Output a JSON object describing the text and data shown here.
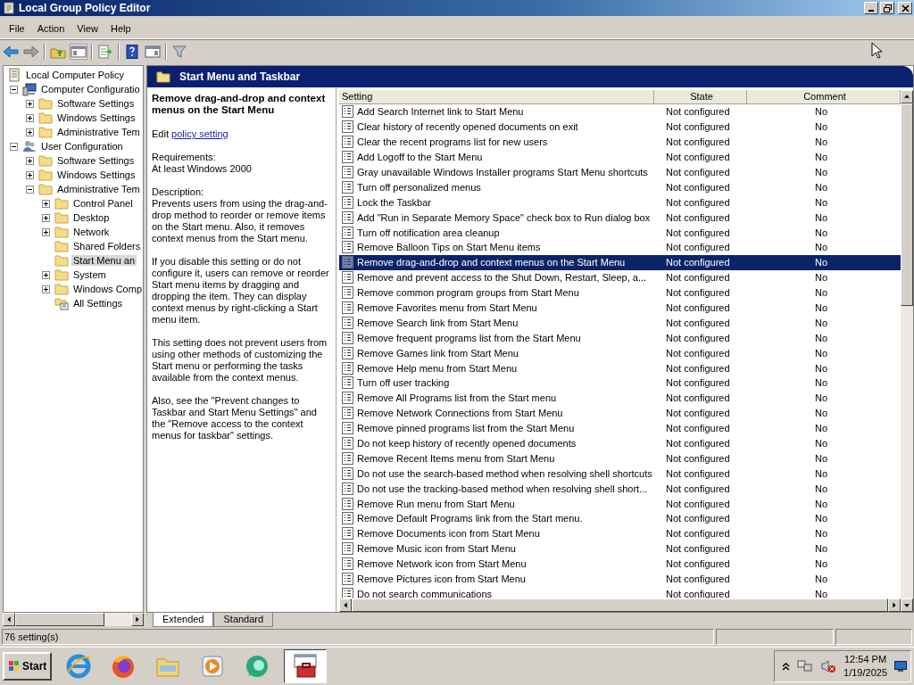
{
  "window": {
    "title": "Local Group Policy Editor"
  },
  "menu": [
    "File",
    "Action",
    "View",
    "Help"
  ],
  "toolbar": [
    {
      "kind": "back"
    },
    {
      "kind": "forward"
    },
    {
      "kind": "sep"
    },
    {
      "kind": "folder-up"
    },
    {
      "kind": "tree-toggle"
    },
    {
      "kind": "sep"
    },
    {
      "kind": "export"
    },
    {
      "kind": "sep"
    },
    {
      "kind": "help"
    },
    {
      "kind": "pane"
    },
    {
      "kind": "sep"
    },
    {
      "kind": "filter"
    }
  ],
  "tree": [
    {
      "label": "Local Computer Policy",
      "kind": "policy",
      "selected": false,
      "children": [
        {
          "label": "Computer Configuratio",
          "kind": "computer",
          "expanded": true,
          "selected": false,
          "children": [
            {
              "label": "Software Settings",
              "kind": "folder",
              "expanded": false,
              "selected": false
            },
            {
              "label": "Windows Settings",
              "kind": "folder",
              "expanded": false,
              "selected": false
            },
            {
              "label": "Administrative Tem",
              "kind": "folder",
              "expanded": false,
              "selected": false
            }
          ]
        },
        {
          "label": "User Configuration",
          "kind": "user",
          "expanded": true,
          "selected": false,
          "children": [
            {
              "label": "Software Settings",
              "kind": "folder",
              "expanded": false,
              "selected": false
            },
            {
              "label": "Windows Settings",
              "kind": "folder",
              "expanded": false,
              "selected": false
            },
            {
              "label": "Administrative Tem",
              "kind": "folder",
              "expanded": true,
              "selected": false,
              "children": [
                {
                  "label": "Control Panel",
                  "kind": "folder",
                  "expanded": false,
                  "selected": false
                },
                {
                  "label": "Desktop",
                  "kind": "folder",
                  "expanded": false,
                  "selected": false
                },
                {
                  "label": "Network",
                  "kind": "folder",
                  "expanded": false,
                  "selected": false
                },
                {
                  "label": "Shared Folders",
                  "kind": "folder",
                  "selected": false
                },
                {
                  "label": "Start Menu an",
                  "kind": "folder",
                  "selected": true
                },
                {
                  "label": "System",
                  "kind": "folder",
                  "expanded": false,
                  "selected": false
                },
                {
                  "label": "Windows Comp",
                  "kind": "folder",
                  "expanded": false,
                  "selected": false
                },
                {
                  "label": "All Settings",
                  "kind": "settings",
                  "selected": false
                }
              ]
            }
          ]
        }
      ]
    }
  ],
  "pane_title": "Start Menu and Taskbar",
  "description": {
    "title": "Remove drag-and-drop and context menus on the Start Menu",
    "edit_prefix": "Edit",
    "edit_link": "policy setting",
    "requirements_label": "Requirements:",
    "requirements": "At least Windows 2000",
    "description_label": "Description:",
    "paragraphs": [
      "Prevents users from using the drag-and-drop method to reorder or remove items on the Start menu. Also, it removes context menus from the Start menu.",
      "If you disable this setting or do not configure it, users can remove or reorder Start menu items by dragging and dropping the item. They can display context menus by right-clicking a Start menu item.",
      "This setting does not prevent users from using other methods of customizing the Start menu or performing the tasks available from the context menus.",
      "Also, see the \"Prevent changes to Taskbar and Start Menu Settings\" and the \"Remove access to the context menus for taskbar\" settings."
    ]
  },
  "table": {
    "columns": [
      "Setting",
      "State",
      "Comment"
    ],
    "rows": [
      {
        "setting": "Add Search Internet link to Start Menu",
        "state": "Not configured",
        "comment": "No",
        "selected": false
      },
      {
        "setting": "Clear history of recently opened documents on exit",
        "state": "Not configured",
        "comment": "No",
        "selected": false
      },
      {
        "setting": "Clear the recent programs list for new users",
        "state": "Not configured",
        "comment": "No",
        "selected": false
      },
      {
        "setting": "Add Logoff to the Start Menu",
        "state": "Not configured",
        "comment": "No",
        "selected": false
      },
      {
        "setting": "Gray unavailable Windows Installer programs Start Menu shortcuts",
        "state": "Not configured",
        "comment": "No",
        "selected": false
      },
      {
        "setting": "Turn off personalized menus",
        "state": "Not configured",
        "comment": "No",
        "selected": false
      },
      {
        "setting": "Lock the Taskbar",
        "state": "Not configured",
        "comment": "No",
        "selected": false
      },
      {
        "setting": "Add \"Run in Separate Memory Space\" check box to Run dialog box",
        "state": "Not configured",
        "comment": "No",
        "selected": false
      },
      {
        "setting": "Turn off notification area cleanup",
        "state": "Not configured",
        "comment": "No",
        "selected": false
      },
      {
        "setting": "Remove Balloon Tips on Start Menu items",
        "state": "Not configured",
        "comment": "No",
        "selected": false
      },
      {
        "setting": "Remove drag-and-drop and context menus on the Start Menu",
        "state": "Not configured",
        "comment": "No",
        "selected": true
      },
      {
        "setting": "Remove and prevent access to the Shut Down, Restart, Sleep, a...",
        "state": "Not configured",
        "comment": "No",
        "selected": false
      },
      {
        "setting": "Remove common program groups from Start Menu",
        "state": "Not configured",
        "comment": "No",
        "selected": false
      },
      {
        "setting": "Remove Favorites menu from Start Menu",
        "state": "Not configured",
        "comment": "No",
        "selected": false
      },
      {
        "setting": "Remove Search link from Start Menu",
        "state": "Not configured",
        "comment": "No",
        "selected": false
      },
      {
        "setting": "Remove frequent programs list from the Start Menu",
        "state": "Not configured",
        "comment": "No",
        "selected": false
      },
      {
        "setting": "Remove Games link from Start Menu",
        "state": "Not configured",
        "comment": "No",
        "selected": false
      },
      {
        "setting": "Remove Help menu from Start Menu",
        "state": "Not configured",
        "comment": "No",
        "selected": false
      },
      {
        "setting": "Turn off user tracking",
        "state": "Not configured",
        "comment": "No",
        "selected": false
      },
      {
        "setting": "Remove All Programs list from the Start menu",
        "state": "Not configured",
        "comment": "No",
        "selected": false
      },
      {
        "setting": "Remove Network Connections from Start Menu",
        "state": "Not configured",
        "comment": "No",
        "selected": false
      },
      {
        "setting": "Remove pinned programs list from the Start Menu",
        "state": "Not configured",
        "comment": "No",
        "selected": false
      },
      {
        "setting": "Do not keep history of recently opened documents",
        "state": "Not configured",
        "comment": "No",
        "selected": false
      },
      {
        "setting": "Remove Recent Items menu from Start Menu",
        "state": "Not configured",
        "comment": "No",
        "selected": false
      },
      {
        "setting": "Do not use the search-based method when resolving shell shortcuts",
        "state": "Not configured",
        "comment": "No",
        "selected": false
      },
      {
        "setting": "Do not use the tracking-based method when resolving shell short...",
        "state": "Not configured",
        "comment": "No",
        "selected": false
      },
      {
        "setting": "Remove Run menu from Start Menu",
        "state": "Not configured",
        "comment": "No",
        "selected": false
      },
      {
        "setting": "Remove Default Programs link from the Start menu.",
        "state": "Not configured",
        "comment": "No",
        "selected": false
      },
      {
        "setting": "Remove Documents icon from Start Menu",
        "state": "Not configured",
        "comment": "No",
        "selected": false
      },
      {
        "setting": "Remove Music icon from Start Menu",
        "state": "Not configured",
        "comment": "No",
        "selected": false
      },
      {
        "setting": "Remove Network icon from Start Menu",
        "state": "Not configured",
        "comment": "No",
        "selected": false
      },
      {
        "setting": "Remove Pictures icon from Start Menu",
        "state": "Not configured",
        "comment": "No",
        "selected": false
      },
      {
        "setting": "Do not search communications",
        "state": "Not configured",
        "comment": "No",
        "selected": false
      }
    ]
  },
  "view_tabs": [
    {
      "label": "Extended",
      "selected": true
    },
    {
      "label": "Standard",
      "selected": false
    }
  ],
  "status_bar": "76 setting(s)",
  "taskbar": {
    "start": "Start",
    "apps": [
      {
        "kind": "ie",
        "selected": false
      },
      {
        "kind": "firefox",
        "selected": false
      },
      {
        "kind": "explorer",
        "selected": false
      },
      {
        "kind": "media",
        "selected": false
      },
      {
        "kind": "chat",
        "selected": false
      },
      {
        "kind": "toolbox",
        "selected": true
      }
    ],
    "time": "12:54 PM",
    "date": "1/19/2025"
  }
}
